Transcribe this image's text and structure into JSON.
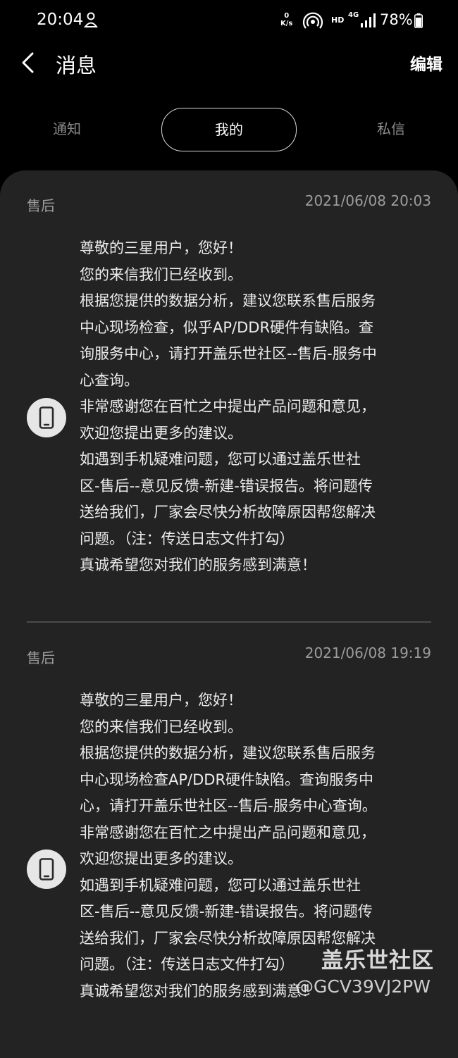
{
  "status_bar": {
    "time": "20:04",
    "speed_value": "0",
    "speed_unit": "K/s",
    "hd": "HD",
    "network": "4G",
    "battery": "78%"
  },
  "header": {
    "title": "消息",
    "edit_label": "编辑"
  },
  "tabs": [
    {
      "label": "通知",
      "active": false
    },
    {
      "label": "我的",
      "active": true
    },
    {
      "label": "私信",
      "active": false
    }
  ],
  "messages": [
    {
      "category": "售后",
      "time": "2021/06/08 20:03",
      "lines": [
        "尊敬的三星用户，您好！",
        "您的来信我们已经收到。",
        "根据您提供的数据分析，建议您联系售后服务",
        "中心现场检查，似乎AP/DDR硬件有缺陷。查",
        "询服务中心，请打开盖乐世社区--售后-服务中",
        "心查询。",
        "非常感谢您在百忙之中提出产品问题和意见，",
        "欢迎您提出更多的建议。",
        "如遇到手机疑难问题，您可以通过盖乐世社",
        "区-售后--意见反馈-新建-错误报告。将问题传",
        "送给我们，厂家会尽快分析故障原因帮您解决",
        "问题。（注：传送日志文件打勾）",
        "真诚希望您对我们的服务感到满意！"
      ]
    },
    {
      "category": "售后",
      "time": "2021/06/08 19:19",
      "lines": [
        "尊敬的三星用户，您好！",
        "您的来信我们已经收到。",
        "根据您提供的数据分析，建议您联系售后服务",
        "中心现场检查AP/DDR硬件缺陷。查询服务中",
        "心，请打开盖乐世社区--售后-服务中心查询。",
        "非常感谢您在百忙之中提出产品问题和意见，",
        "欢迎您提出更多的建议。",
        "如遇到手机疑难问题，您可以通过盖乐世社",
        "区-售后--意见反馈-新建-错误报告。将问题传",
        "送给我们，厂家会尽快分析故障原因帮您解决",
        "问题。（注：传送日志文件打勾）",
        "真诚希望您对我们的服务感到满意！"
      ]
    }
  ],
  "watermark": {
    "logo": "盖乐世社区",
    "id": "@GCV39VJ2PW"
  },
  "colors": {
    "background": "#000000",
    "card": "#232323",
    "muted_text": "#9c9c9c",
    "icon_circle": "#e6e6e6"
  }
}
